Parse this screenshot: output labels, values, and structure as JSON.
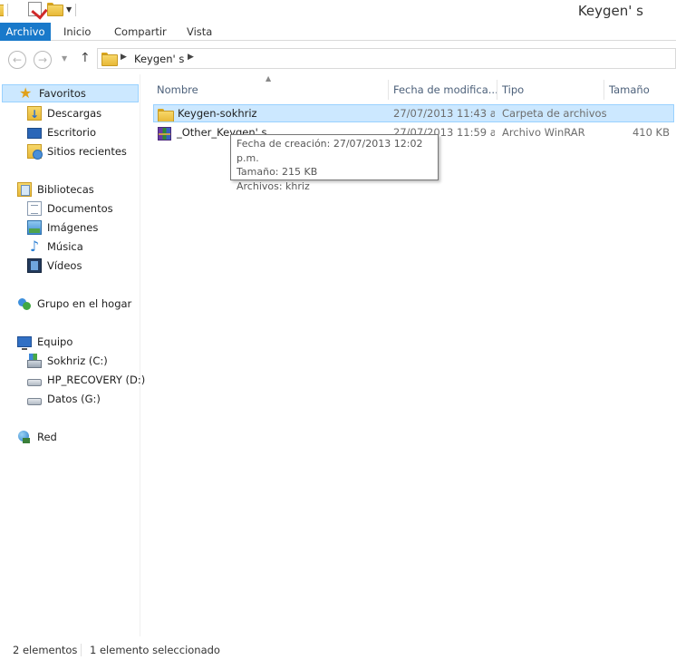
{
  "window": {
    "title": "Keygen' s"
  },
  "ribbon": {
    "tabs": [
      "Archivo",
      "Inicio",
      "Compartir",
      "Vista"
    ]
  },
  "address": {
    "path": "Keygen' s"
  },
  "navigation": {
    "favorites": {
      "label": "Favoritos",
      "items": [
        "Descargas",
        "Escritorio",
        "Sitios recientes"
      ]
    },
    "libraries": {
      "label": "Bibliotecas",
      "items": [
        "Documentos",
        "Imágenes",
        "Música",
        "Vídeos"
      ]
    },
    "homegroup": {
      "label": "Grupo en el hogar"
    },
    "computer": {
      "label": "Equipo",
      "items": [
        "Sokhriz (C:)",
        "HP_RECOVERY (D:)",
        "Datos (G:)"
      ]
    },
    "network": {
      "label": "Red"
    }
  },
  "columns": [
    "Nombre",
    "Fecha de modifica...",
    "Tipo",
    "Tamaño"
  ],
  "files": [
    {
      "name": "Keygen-sokhriz",
      "date": "27/07/2013 11:43 a...",
      "type": "Carpeta de archivos",
      "size": ""
    },
    {
      "name": "_Other_Keygen' s",
      "date": "27/07/2013 11:59 a...",
      "type": "Archivo WinRAR",
      "size": "410 KB"
    }
  ],
  "tooltip": {
    "line1": "Fecha de creación: 27/07/2013 12:02 p.m.",
    "line2": "Tamaño: 215 KB",
    "line3": "Archivos: khriz"
  },
  "status": {
    "count": "2 elementos",
    "selected": "1 elemento seleccionado"
  }
}
